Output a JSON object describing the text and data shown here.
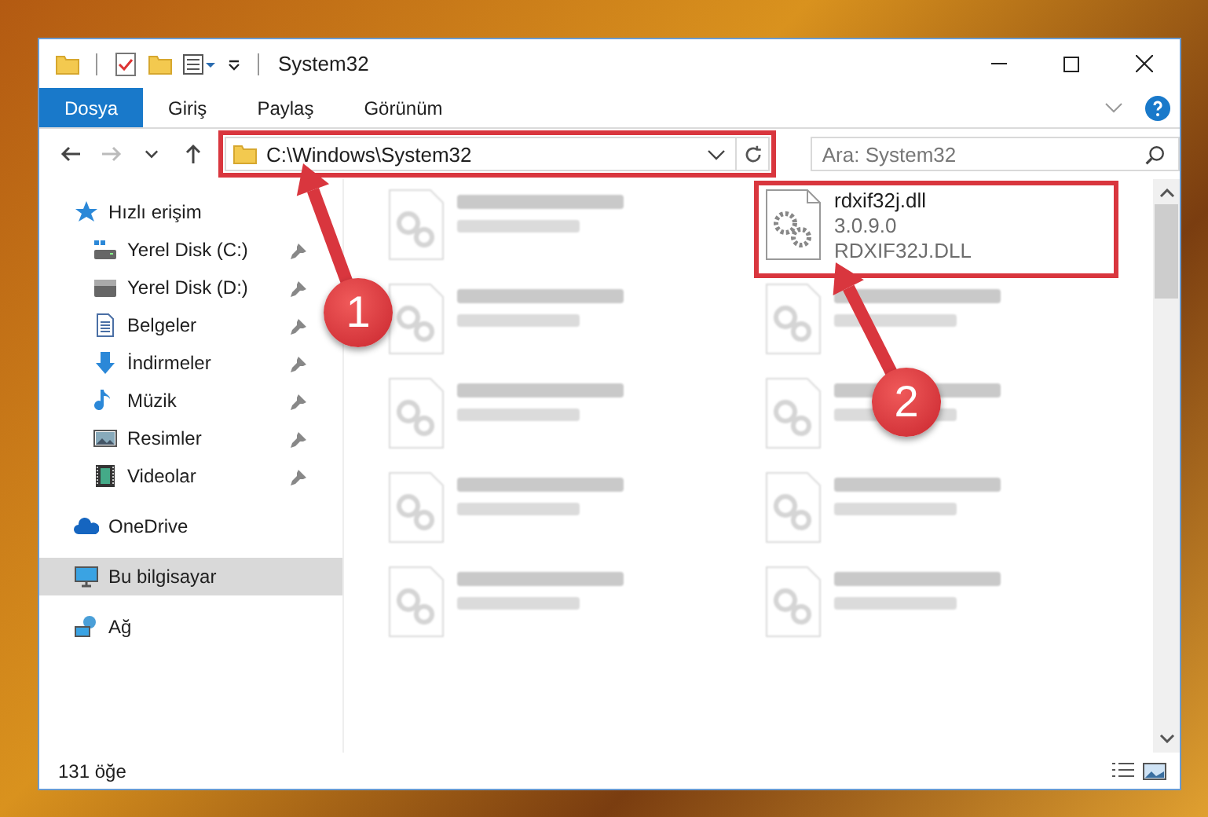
{
  "window": {
    "title": "System32"
  },
  "ribbon_tabs": [
    {
      "label": "Dosya",
      "selected": true
    },
    {
      "label": "Giriş",
      "selected": false
    },
    {
      "label": "Paylaş",
      "selected": false
    },
    {
      "label": "Görünüm",
      "selected": false
    }
  ],
  "navigation": [
    {
      "kind": "back",
      "disabled": false
    },
    {
      "kind": "forward",
      "disabled": true
    },
    {
      "kind": "recent",
      "disabled": false
    },
    {
      "kind": "up",
      "disabled": false
    }
  ],
  "address": {
    "value": "C:\\Windows\\System32",
    "framed": true
  },
  "search": {
    "placeholder": "Ara: System32"
  },
  "sidebar": {
    "items": [
      {
        "label": "Hızlı erişim",
        "kind": "star",
        "selected": false,
        "pinned": false,
        "children": [
          {
            "label": "Yerel Disk (C:)",
            "kind": "system-drive",
            "selected": false,
            "pinned": true
          },
          {
            "label": "Yerel Disk (D:)",
            "kind": "drive",
            "selected": false,
            "pinned": true
          },
          {
            "label": "Belgeler",
            "kind": "document",
            "selected": false,
            "pinned": true
          },
          {
            "label": "İndirmeler",
            "kind": "download",
            "selected": false,
            "pinned": true
          },
          {
            "label": "Müzik",
            "kind": "music",
            "selected": false,
            "pinned": true
          },
          {
            "label": "Resimler",
            "kind": "pictures",
            "selected": false,
            "pinned": true
          },
          {
            "label": "Videolar",
            "kind": "videos",
            "selected": false,
            "pinned": true
          }
        ]
      },
      {
        "label": "OneDrive",
        "kind": "cloud",
        "selected": false,
        "pinned": false
      },
      {
        "label": "Bu bilgisayar",
        "kind": "computer",
        "selected": true,
        "pinned": false
      },
      {
        "label": "Ağ",
        "kind": "network",
        "selected": false,
        "pinned": false
      }
    ]
  },
  "files": [
    {
      "kind": "blurred"
    },
    {
      "kind": "file",
      "name": "rdxif32j.dll",
      "details": [
        "3.0.9.0",
        "RDXIF32J.DLL"
      ],
      "framed": true
    },
    {
      "kind": "blurred"
    },
    {
      "kind": "blurred"
    },
    {
      "kind": "blurred"
    },
    {
      "kind": "blurred"
    },
    {
      "kind": "blurred"
    },
    {
      "kind": "blurred"
    },
    {
      "kind": "blurred"
    },
    {
      "kind": "blurred"
    }
  ],
  "status_bar": {
    "count": "131 öğe"
  },
  "annotations": [
    {
      "number": "1"
    },
    {
      "number": "2"
    }
  ]
}
